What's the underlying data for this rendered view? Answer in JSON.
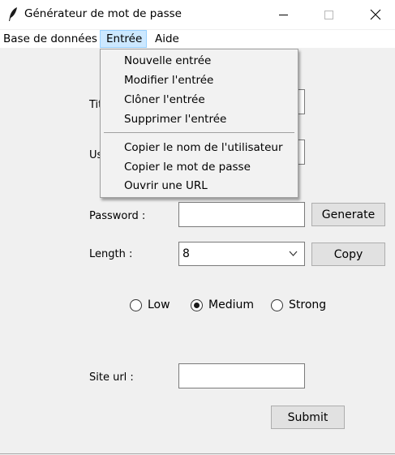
{
  "window": {
    "title": "Générateur de mot de passe",
    "icon": "feather-icon",
    "controls": [
      "minimize-icon",
      "maximize-icon",
      "close-icon"
    ]
  },
  "menubar": {
    "items": [
      "Base de données",
      "Entrée",
      "Aide"
    ],
    "active": "Entrée"
  },
  "dropdown": {
    "items": [
      "Nouvelle entrée",
      "Modifier l'entrée",
      "Clôner l'entrée",
      "Supprimer l'entrée",
      "Copier le nom de l'utilisateur",
      "Copier le mot de passe",
      "Ouvrir une URL"
    ]
  },
  "form": {
    "title_label_partial": "Tit",
    "user_label_partial": "Us",
    "title_value": "",
    "user_value": "",
    "password_label": "Password :",
    "password_value": "",
    "generate_label": "Generate",
    "length_label": "Length :",
    "length_value": "8",
    "copy_label": "Copy",
    "strength_options": [
      "Low",
      "Medium",
      "Strong"
    ],
    "strength_selected": "Medium",
    "site_url_label": "Site url :",
    "site_url_value": "",
    "submit_label": "Submit"
  },
  "colors": {
    "background": "#f0f0f0",
    "menu_highlight": "#cce8ff",
    "button_face": "#e1e1e1"
  }
}
